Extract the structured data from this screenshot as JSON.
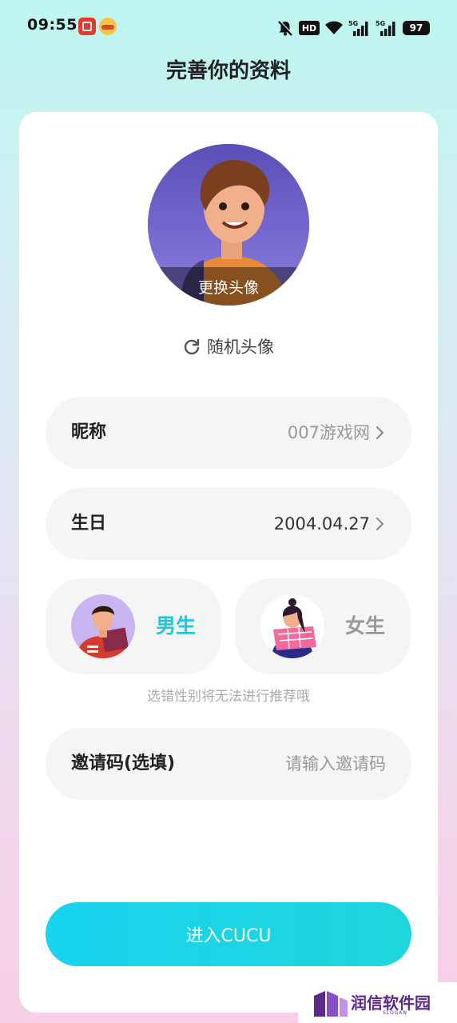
{
  "status_bar": {
    "time": "09:55",
    "hd": "HD",
    "battery": "97",
    "icons": [
      "mute-icon",
      "hd-icon",
      "wifi-icon",
      "5g-signal-icon",
      "5g-signal-icon",
      "battery-icon"
    ]
  },
  "header": {
    "title": "完善你的资料"
  },
  "avatar": {
    "caption": "更换头像"
  },
  "random_avatar": {
    "label": "随机头像",
    "icon": "refresh-icon"
  },
  "nickname": {
    "label": "昵称",
    "value": "007游戏网"
  },
  "birthday": {
    "label": "生日",
    "value": "2004.04.27"
  },
  "gender": {
    "male_label": "男生",
    "female_label": "女生",
    "selected": "male",
    "hint": "选错性别将无法进行推荐哦"
  },
  "invite": {
    "label": "邀请码(选填)",
    "placeholder": "请输入邀请码"
  },
  "submit": {
    "label": "进入CUCU"
  },
  "watermark": {
    "text": "润信软件园",
    "slogan": "SLOGAN"
  },
  "colors": {
    "accent": "#1fc7d8",
    "button_start": "#18d3ef",
    "button_end": "#1ed5db"
  }
}
